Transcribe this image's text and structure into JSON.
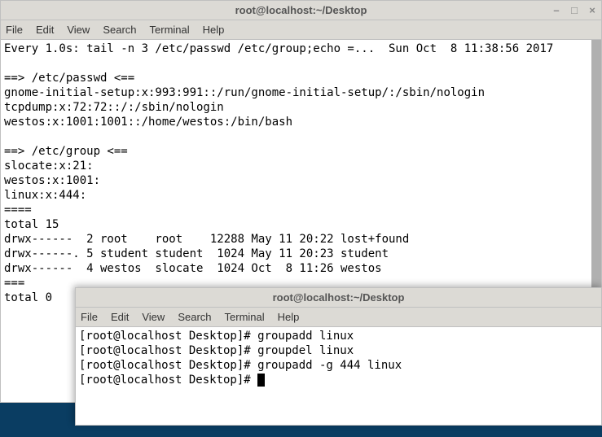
{
  "menu": {
    "file": "File",
    "edit": "Edit",
    "view": "View",
    "search": "Search",
    "terminal": "Terminal",
    "help": "Help"
  },
  "back": {
    "title": "root@localhost:~/Desktop",
    "lines": [
      "Every 1.0s: tail -n 3 /etc/passwd /etc/group;echo =...  Sun Oct  8 11:38:56 2017",
      "",
      "==> /etc/passwd <==",
      "gnome-initial-setup:x:993:991::/run/gnome-initial-setup/:/sbin/nologin",
      "tcpdump:x:72:72::/:/sbin/nologin",
      "westos:x:1001:1001::/home/westos:/bin/bash",
      "",
      "==> /etc/group <==",
      "slocate:x:21:",
      "westos:x:1001:",
      "linux:x:444:",
      "====",
      "total 15",
      "drwx------  2 root    root    12288 May 11 20:22 lost+found",
      "drwx------. 5 student student  1024 May 11 20:23 student",
      "drwx------  4 westos  slocate  1024 Oct  8 11:26 westos",
      "===",
      "total 0"
    ]
  },
  "front": {
    "title": "root@localhost:~/Desktop",
    "history": [
      {
        "prompt": "[root@localhost Desktop]# ",
        "cmd": "groupadd linux"
      },
      {
        "prompt": "[root@localhost Desktop]# ",
        "cmd": "groupdel linux"
      },
      {
        "prompt": "[root@localhost Desktop]# ",
        "cmd": "groupadd -g 444 linux"
      }
    ],
    "current_prompt": "[root@localhost Desktop]# "
  }
}
